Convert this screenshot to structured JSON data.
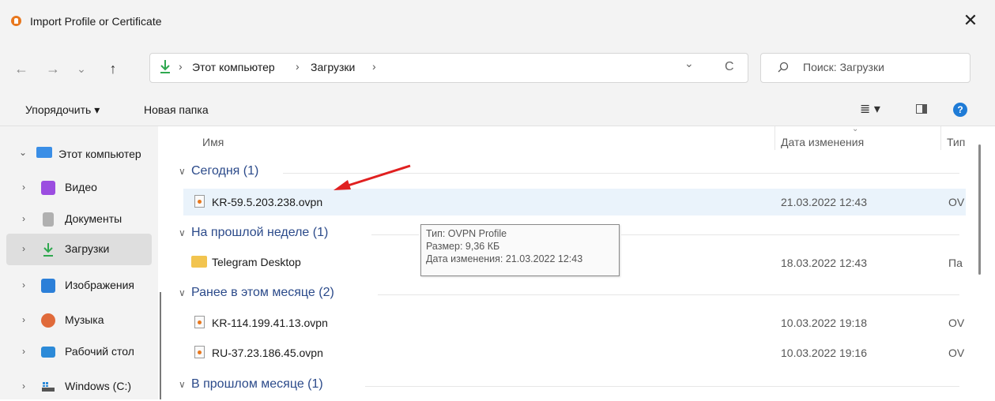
{
  "window": {
    "title": "Import Profile or Certificate",
    "close": "✕"
  },
  "nav": {
    "back": "←",
    "forward": "→",
    "recent": "⌄",
    "up": "↑",
    "breadcrumb": [
      "Этот компьютер",
      "Загрузки"
    ],
    "sep": "›",
    "dropdown": "⌄",
    "refresh": "C",
    "search_placeholder": "Поиск: Загрузки"
  },
  "toolbar": {
    "organize": "Упорядочить ▾",
    "new_folder": "Новая папка",
    "view": "≣ ▾",
    "help": "?"
  },
  "sidebar": {
    "items": [
      {
        "label": "Этот компьютер",
        "chev": "⌄",
        "color": "#3a8ee6"
      },
      {
        "label": "Видео",
        "chev": "›",
        "color": "#9b4de0"
      },
      {
        "label": "Документы",
        "chev": "›",
        "color": "#8a8a8a"
      },
      {
        "label": "Загрузки",
        "chev": "›",
        "color": "#2fa84f"
      },
      {
        "label": "Изображения",
        "chev": "›",
        "color": "#2c7fd8"
      },
      {
        "label": "Музыка",
        "chev": "›",
        "color": "#e06a3a"
      },
      {
        "label": "Рабочий стол",
        "chev": "›",
        "color": "#2c8ad8"
      },
      {
        "label": "Windows (C:)",
        "chev": "›",
        "color": "#555555"
      }
    ]
  },
  "columns": {
    "name": "Имя",
    "date": "Дата изменения",
    "type": "Тип"
  },
  "groups": [
    {
      "label": "Сегодня (1)"
    },
    {
      "label": "На прошлой неделе (1)"
    },
    {
      "label": "Ранее в этом месяце (2)"
    },
    {
      "label": "В прошлом месяце (1)"
    }
  ],
  "files": [
    {
      "name": "KR-59.5.203.238.ovpn",
      "date": "21.03.2022 12:43",
      "type": "OV"
    },
    {
      "name": "Telegram Desktop",
      "date": "18.03.2022 12:43",
      "type": "Па"
    },
    {
      "name": "KR-114.199.41.13.ovpn",
      "date": "10.03.2022 19:18",
      "type": "OV"
    },
    {
      "name": "RU-37.23.186.45.ovpn",
      "date": "10.03.2022 19:16",
      "type": "OV"
    }
  ],
  "tooltip": {
    "type": "Тип: OVPN Profile",
    "size": "Размер: 9,36 КБ",
    "modified": "Дата изменения: 21.03.2022 12:43"
  }
}
